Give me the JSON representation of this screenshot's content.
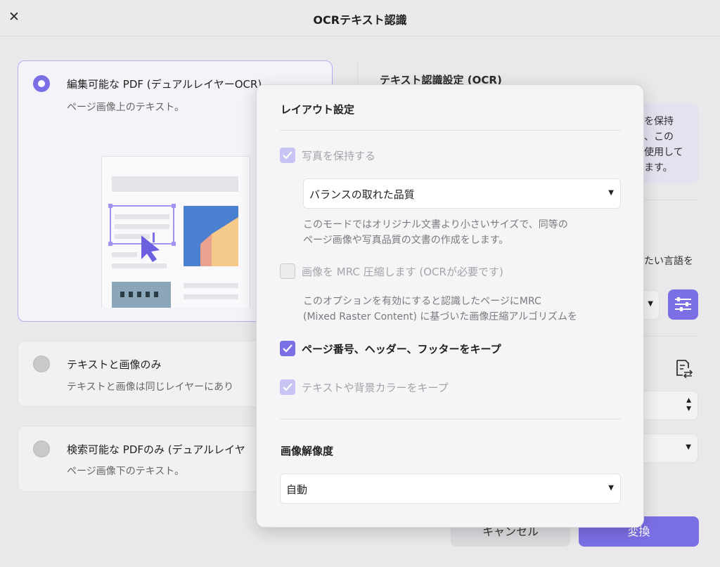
{
  "window": {
    "title": "OCRテキスト認識",
    "close_symbol": "✕"
  },
  "options": [
    {
      "title": "編集可能な PDF (デュアルレイヤーOCR)",
      "description": "ページ画像上のテキスト。",
      "selected": true
    },
    {
      "title": "テキストと画像のみ",
      "description": "テキストと画像は同じレイヤーにあり",
      "selected": false
    },
    {
      "title": "検索可能な PDFのみ (デュアルレイヤ",
      "description": "ページ画像下のテキスト。",
      "selected": false
    }
  ],
  "right_panel": {
    "title": "テキスト認識設定 (OCR)",
    "info_lines": [
      "を保持",
      "、この",
      "使用して",
      "ます。"
    ],
    "language_hint": "たい言語を"
  },
  "popup": {
    "layout_heading": "レイアウト設定",
    "keep_photos": {
      "label": "写真を保持する",
      "checked": true,
      "enabled": false
    },
    "quality_select": {
      "value": "バランスの取れた品質"
    },
    "quality_desc": [
      "このモードではオリジナル文書より小さいサイズで、同等の",
      "ページ画像や写真品質の文書の作成をします。"
    ],
    "mrc": {
      "label": "画像を MRC 圧縮します (OCRが必要です)",
      "checked": false,
      "enabled": false
    },
    "mrc_desc": [
      "このオプションを有効にすると認識したページにMRC",
      "(Mixed Raster Content) に基づいた画像圧縮アルゴリズムを"
    ],
    "keep_header_footer": {
      "label": "ページ番号、ヘッダー、フッターをキープ",
      "checked": true,
      "enabled": true
    },
    "keep_colors": {
      "label": "テキストや背景カラーをキープ",
      "checked": true,
      "enabled": false
    },
    "resolution_heading": "画像解像度",
    "resolution_select": {
      "value": "自動"
    }
  },
  "buttons": {
    "cancel": "キャンセル",
    "convert": "変換"
  },
  "colors": {
    "accent": "#7b6fe6",
    "accent_dim": "#c7c3f2",
    "background": "#e9e9eb"
  }
}
